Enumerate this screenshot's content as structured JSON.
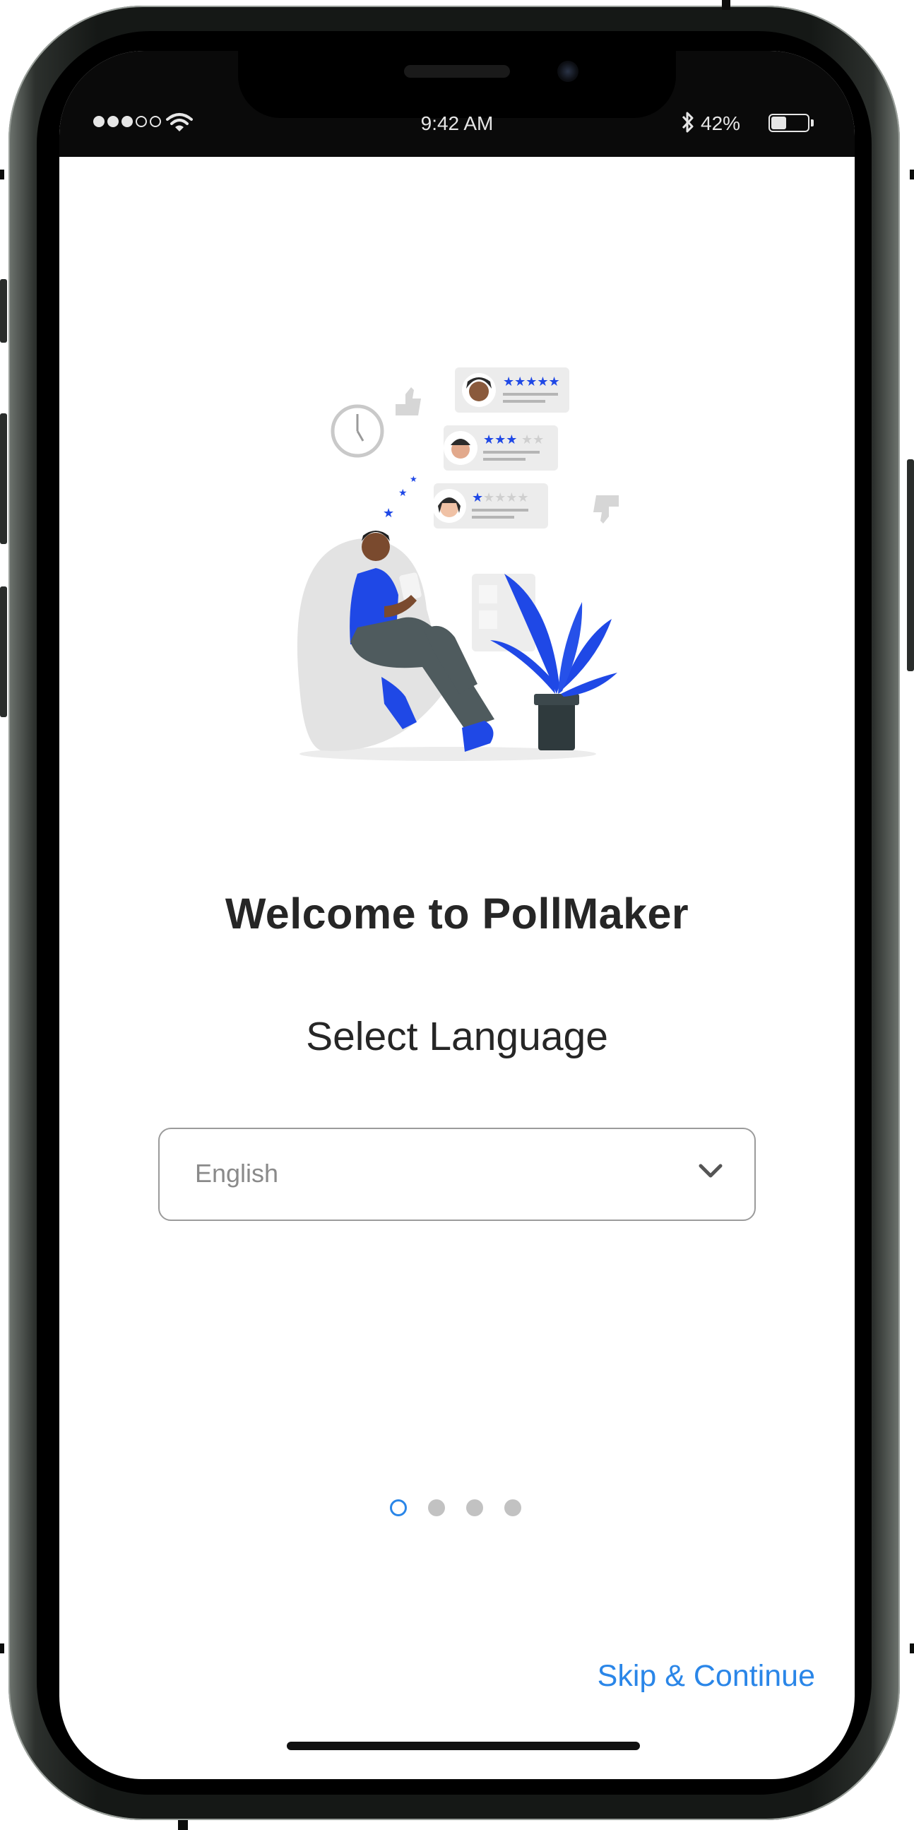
{
  "status_bar": {
    "time": "9:42 AM",
    "battery_percent": "42%",
    "battery_level": 0.42,
    "signal_bars_on": 3,
    "signal_bars_total": 5,
    "icons": [
      "signal-dots-icon",
      "wifi-icon",
      "bluetooth-icon",
      "battery-icon"
    ]
  },
  "onboarding": {
    "illustration": "person-reviewing-ratings-illustration",
    "title": "Welcome to PollMaker",
    "subtitle": "Select Language",
    "language_select": {
      "value": "English",
      "icon": "chevron-down-icon"
    },
    "pager": {
      "total": 4,
      "current": 1
    },
    "skip_label": "Skip & Continue"
  },
  "colors": {
    "accent": "#2a86e8",
    "illustration_blue": "#1f48e6",
    "text": "#262626",
    "border": "#9b9b9b",
    "inactive_dot": "#c2c2c2"
  }
}
